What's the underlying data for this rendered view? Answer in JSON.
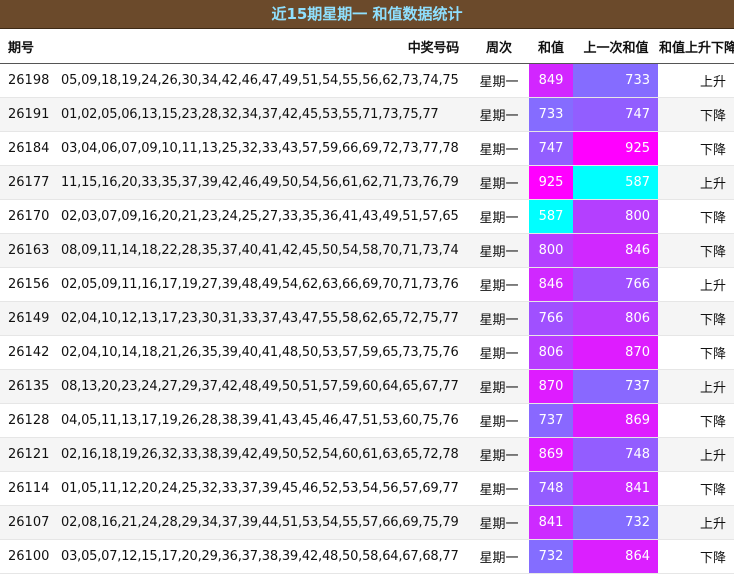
{
  "title": "近15期星期一 和值数据统计",
  "headers": {
    "issue": "期号",
    "numbers": "中奖号码",
    "weekday": "周次",
    "sum": "和值",
    "prev_sum": "上一次和值",
    "trend": "和值上升下降"
  },
  "colors": {
    "title_bg": "#6b4a2b",
    "title_text": "#8fe0ff",
    "scale_low": "#00ffff",
    "scale_mid": "#9a55ff",
    "scale_high": "#ff00ff",
    "scale_min_value": 587,
    "scale_max_value": 925
  },
  "rows": [
    {
      "issue": "26198",
      "numbers": "05,09,18,19,24,26,30,34,42,46,47,49,51,54,55,56,62,73,74,75",
      "weekday": "星期一",
      "sum": 849,
      "prev_sum": 733,
      "trend": "上升"
    },
    {
      "issue": "26191",
      "numbers": "01,02,05,06,13,15,23,28,32,34,37,42,45,53,55,71,73,75,77",
      "weekday": "星期一",
      "sum": 733,
      "prev_sum": 747,
      "trend": "下降"
    },
    {
      "issue": "26184",
      "numbers": "03,04,06,07,09,10,11,13,25,32,33,43,57,59,66,69,72,73,77,78",
      "weekday": "星期一",
      "sum": 747,
      "prev_sum": 925,
      "trend": "下降"
    },
    {
      "issue": "26177",
      "numbers": "11,15,16,20,33,35,37,39,42,46,49,50,54,56,61,62,71,73,76,79",
      "weekday": "星期一",
      "sum": 925,
      "prev_sum": 587,
      "trend": "上升"
    },
    {
      "issue": "26170",
      "numbers": "02,03,07,09,16,20,21,23,24,25,27,33,35,36,41,43,49,51,57,65",
      "weekday": "星期一",
      "sum": 587,
      "prev_sum": 800,
      "trend": "下降"
    },
    {
      "issue": "26163",
      "numbers": "08,09,11,14,18,22,28,35,37,40,41,42,45,50,54,58,70,71,73,74",
      "weekday": "星期一",
      "sum": 800,
      "prev_sum": 846,
      "trend": "下降"
    },
    {
      "issue": "26156",
      "numbers": "02,05,09,11,16,17,19,27,39,48,49,54,62,63,66,69,70,71,73,76",
      "weekday": "星期一",
      "sum": 846,
      "prev_sum": 766,
      "trend": "上升"
    },
    {
      "issue": "26149",
      "numbers": "02,04,10,12,13,17,23,30,31,33,37,43,47,55,58,62,65,72,75,77",
      "weekday": "星期一",
      "sum": 766,
      "prev_sum": 806,
      "trend": "下降"
    },
    {
      "issue": "26142",
      "numbers": "02,04,10,14,18,21,26,35,39,40,41,48,50,53,57,59,65,73,75,76",
      "weekday": "星期一",
      "sum": 806,
      "prev_sum": 870,
      "trend": "下降"
    },
    {
      "issue": "26135",
      "numbers": "08,13,20,23,24,27,29,37,42,48,49,50,51,57,59,60,64,65,67,77",
      "weekday": "星期一",
      "sum": 870,
      "prev_sum": 737,
      "trend": "上升"
    },
    {
      "issue": "26128",
      "numbers": "04,05,11,13,17,19,26,28,38,39,41,43,45,46,47,51,53,60,75,76",
      "weekday": "星期一",
      "sum": 737,
      "prev_sum": 869,
      "trend": "下降"
    },
    {
      "issue": "26121",
      "numbers": "02,16,18,19,26,32,33,38,39,42,49,50,52,54,60,61,63,65,72,78",
      "weekday": "星期一",
      "sum": 869,
      "prev_sum": 748,
      "trend": "上升"
    },
    {
      "issue": "26114",
      "numbers": "01,05,11,12,20,24,25,32,33,37,39,45,46,52,53,54,56,57,69,77",
      "weekday": "星期一",
      "sum": 748,
      "prev_sum": 841,
      "trend": "下降"
    },
    {
      "issue": "26107",
      "numbers": "02,08,16,21,24,28,29,34,37,39,44,51,53,54,55,57,66,69,75,79",
      "weekday": "星期一",
      "sum": 841,
      "prev_sum": 732,
      "trend": "上升"
    },
    {
      "issue": "26100",
      "numbers": "03,05,07,12,15,17,20,29,36,37,38,39,42,48,50,58,64,67,68,77",
      "weekday": "星期一",
      "sum": 732,
      "prev_sum": 864,
      "trend": "下降"
    }
  ]
}
